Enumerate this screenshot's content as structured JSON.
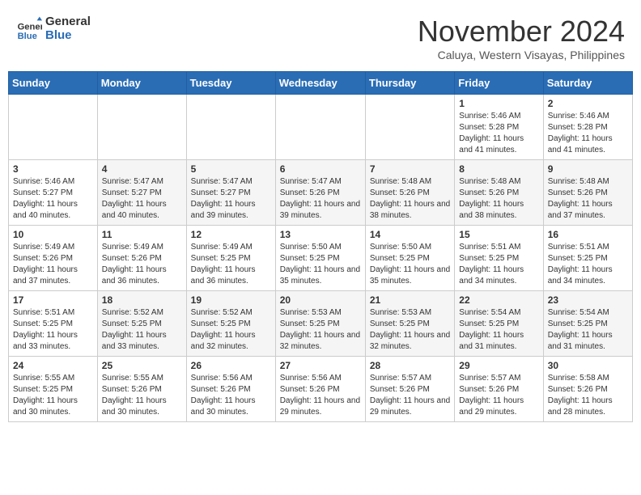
{
  "header": {
    "logo_line1": "General",
    "logo_line2": "Blue",
    "month_title": "November 2024",
    "location": "Caluya, Western Visayas, Philippines"
  },
  "weekdays": [
    "Sunday",
    "Monday",
    "Tuesday",
    "Wednesday",
    "Thursday",
    "Friday",
    "Saturday"
  ],
  "weeks": [
    [
      {
        "day": "",
        "info": ""
      },
      {
        "day": "",
        "info": ""
      },
      {
        "day": "",
        "info": ""
      },
      {
        "day": "",
        "info": ""
      },
      {
        "day": "",
        "info": ""
      },
      {
        "day": "1",
        "info": "Sunrise: 5:46 AM\nSunset: 5:28 PM\nDaylight: 11 hours and 41 minutes."
      },
      {
        "day": "2",
        "info": "Sunrise: 5:46 AM\nSunset: 5:28 PM\nDaylight: 11 hours and 41 minutes."
      }
    ],
    [
      {
        "day": "3",
        "info": "Sunrise: 5:46 AM\nSunset: 5:27 PM\nDaylight: 11 hours and 40 minutes."
      },
      {
        "day": "4",
        "info": "Sunrise: 5:47 AM\nSunset: 5:27 PM\nDaylight: 11 hours and 40 minutes."
      },
      {
        "day": "5",
        "info": "Sunrise: 5:47 AM\nSunset: 5:27 PM\nDaylight: 11 hours and 39 minutes."
      },
      {
        "day": "6",
        "info": "Sunrise: 5:47 AM\nSunset: 5:26 PM\nDaylight: 11 hours and 39 minutes."
      },
      {
        "day": "7",
        "info": "Sunrise: 5:48 AM\nSunset: 5:26 PM\nDaylight: 11 hours and 38 minutes."
      },
      {
        "day": "8",
        "info": "Sunrise: 5:48 AM\nSunset: 5:26 PM\nDaylight: 11 hours and 38 minutes."
      },
      {
        "day": "9",
        "info": "Sunrise: 5:48 AM\nSunset: 5:26 PM\nDaylight: 11 hours and 37 minutes."
      }
    ],
    [
      {
        "day": "10",
        "info": "Sunrise: 5:49 AM\nSunset: 5:26 PM\nDaylight: 11 hours and 37 minutes."
      },
      {
        "day": "11",
        "info": "Sunrise: 5:49 AM\nSunset: 5:26 PM\nDaylight: 11 hours and 36 minutes."
      },
      {
        "day": "12",
        "info": "Sunrise: 5:49 AM\nSunset: 5:25 PM\nDaylight: 11 hours and 36 minutes."
      },
      {
        "day": "13",
        "info": "Sunrise: 5:50 AM\nSunset: 5:25 PM\nDaylight: 11 hours and 35 minutes."
      },
      {
        "day": "14",
        "info": "Sunrise: 5:50 AM\nSunset: 5:25 PM\nDaylight: 11 hours and 35 minutes."
      },
      {
        "day": "15",
        "info": "Sunrise: 5:51 AM\nSunset: 5:25 PM\nDaylight: 11 hours and 34 minutes."
      },
      {
        "day": "16",
        "info": "Sunrise: 5:51 AM\nSunset: 5:25 PM\nDaylight: 11 hours and 34 minutes."
      }
    ],
    [
      {
        "day": "17",
        "info": "Sunrise: 5:51 AM\nSunset: 5:25 PM\nDaylight: 11 hours and 33 minutes."
      },
      {
        "day": "18",
        "info": "Sunrise: 5:52 AM\nSunset: 5:25 PM\nDaylight: 11 hours and 33 minutes."
      },
      {
        "day": "19",
        "info": "Sunrise: 5:52 AM\nSunset: 5:25 PM\nDaylight: 11 hours and 32 minutes."
      },
      {
        "day": "20",
        "info": "Sunrise: 5:53 AM\nSunset: 5:25 PM\nDaylight: 11 hours and 32 minutes."
      },
      {
        "day": "21",
        "info": "Sunrise: 5:53 AM\nSunset: 5:25 PM\nDaylight: 11 hours and 32 minutes."
      },
      {
        "day": "22",
        "info": "Sunrise: 5:54 AM\nSunset: 5:25 PM\nDaylight: 11 hours and 31 minutes."
      },
      {
        "day": "23",
        "info": "Sunrise: 5:54 AM\nSunset: 5:25 PM\nDaylight: 11 hours and 31 minutes."
      }
    ],
    [
      {
        "day": "24",
        "info": "Sunrise: 5:55 AM\nSunset: 5:25 PM\nDaylight: 11 hours and 30 minutes."
      },
      {
        "day": "25",
        "info": "Sunrise: 5:55 AM\nSunset: 5:26 PM\nDaylight: 11 hours and 30 minutes."
      },
      {
        "day": "26",
        "info": "Sunrise: 5:56 AM\nSunset: 5:26 PM\nDaylight: 11 hours and 30 minutes."
      },
      {
        "day": "27",
        "info": "Sunrise: 5:56 AM\nSunset: 5:26 PM\nDaylight: 11 hours and 29 minutes."
      },
      {
        "day": "28",
        "info": "Sunrise: 5:57 AM\nSunset: 5:26 PM\nDaylight: 11 hours and 29 minutes."
      },
      {
        "day": "29",
        "info": "Sunrise: 5:57 AM\nSunset: 5:26 PM\nDaylight: 11 hours and 29 minutes."
      },
      {
        "day": "30",
        "info": "Sunrise: 5:58 AM\nSunset: 5:26 PM\nDaylight: 11 hours and 28 minutes."
      }
    ]
  ]
}
